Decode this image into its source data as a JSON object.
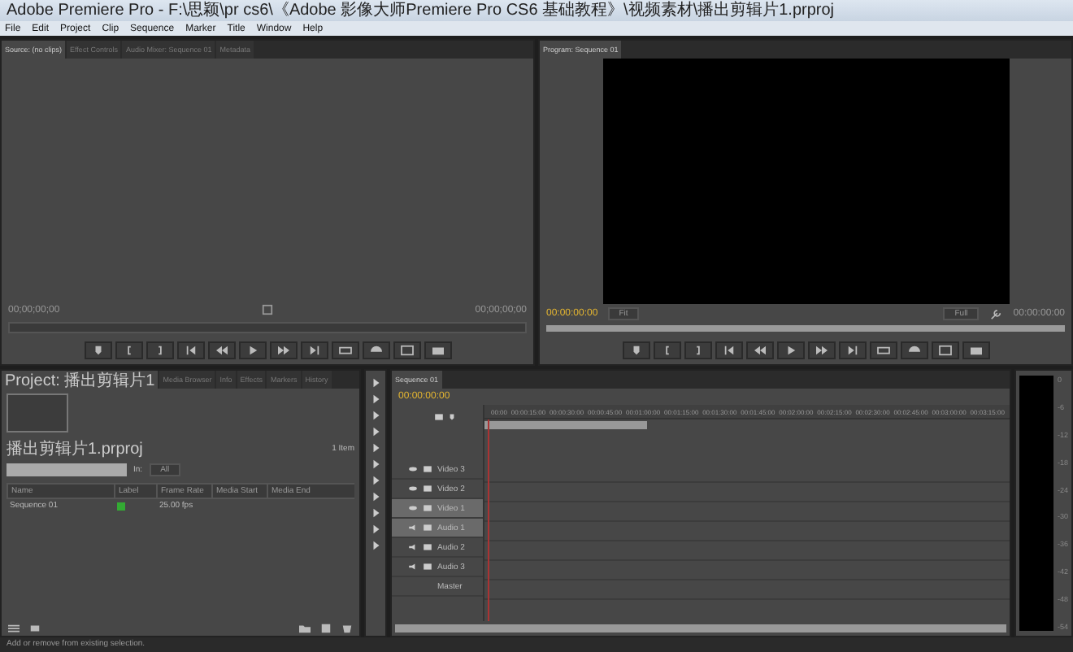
{
  "window": {
    "title": "Adobe Premiere Pro - F:\\思颖\\pr cs6\\《Adobe 影像大师Premiere Pro CS6 基础教程》\\视频素材\\播出剪辑片1.prproj"
  },
  "menu": [
    "File",
    "Edit",
    "Project",
    "Clip",
    "Sequence",
    "Marker",
    "Title",
    "Window",
    "Help"
  ],
  "source_panel": {
    "tabs": [
      {
        "label": "Source: (no clips)",
        "selected": true
      },
      {
        "label": "Effect Controls",
        "selected": false
      },
      {
        "label": "Audio Mixer: Sequence 01",
        "selected": false
      },
      {
        "label": "Metadata",
        "selected": false
      }
    ],
    "timecode_left": "00;00;00;00",
    "timecode_right": "00;00;00;00"
  },
  "program_panel": {
    "tabs": [
      {
        "label": "Program: Sequence 01",
        "selected": true
      }
    ],
    "timecode_left": "00:00:00:00",
    "zoom": "Fit",
    "quality": "Full",
    "timecode_right": "00:00:00:00"
  },
  "project_panel": {
    "tabs": [
      {
        "label": "Project: 播出剪辑片1",
        "selected": true
      },
      {
        "label": "Media Browser",
        "selected": false
      },
      {
        "label": "Info",
        "selected": false
      },
      {
        "label": "Effects",
        "selected": false
      },
      {
        "label": "Markers",
        "selected": false
      },
      {
        "label": "History",
        "selected": false
      }
    ],
    "file": "播出剪辑片1.prproj",
    "item_count": "1 Item",
    "in_label": "In:",
    "in_value": "All",
    "columns": [
      "Name",
      "Label",
      "Frame Rate",
      "Media Start",
      "Media End"
    ],
    "rows": [
      {
        "name": "Sequence 01",
        "color": "#33aa33",
        "frame_rate": "25.00 fps"
      }
    ]
  },
  "timeline": {
    "tabs": [
      {
        "label": "Sequence 01",
        "selected": true
      }
    ],
    "timecode": "00:00:00:00",
    "ruler": [
      "00:00",
      "00:00:15:00",
      "00:00:30:00",
      "00:00:45:00",
      "00:01:00:00",
      "00:01:15:00",
      "00:01:30:00",
      "00:01:45:00",
      "00:02:00:00",
      "00:02:15:00",
      "00:02:30:00",
      "00:02:45:00",
      "00:03:00:00",
      "00:03:15:00"
    ],
    "tracks": [
      {
        "name": "Video 3",
        "kind": "video",
        "selected": false
      },
      {
        "name": "Video 2",
        "kind": "video",
        "selected": false
      },
      {
        "name": "Video 1",
        "kind": "video",
        "selected": true
      },
      {
        "name": "Audio 1",
        "kind": "audio",
        "selected": true
      },
      {
        "name": "Audio 2",
        "kind": "audio",
        "selected": false
      },
      {
        "name": "Audio 3",
        "kind": "audio",
        "selected": false
      },
      {
        "name": "Master",
        "kind": "master",
        "selected": false
      }
    ]
  },
  "audio_meter": {
    "scale": [
      "0",
      "-6",
      "-12",
      "-18",
      "-24",
      "-30",
      "-36",
      "-42",
      "-48",
      "-54"
    ]
  },
  "status_bar": "Add or remove from existing selection."
}
